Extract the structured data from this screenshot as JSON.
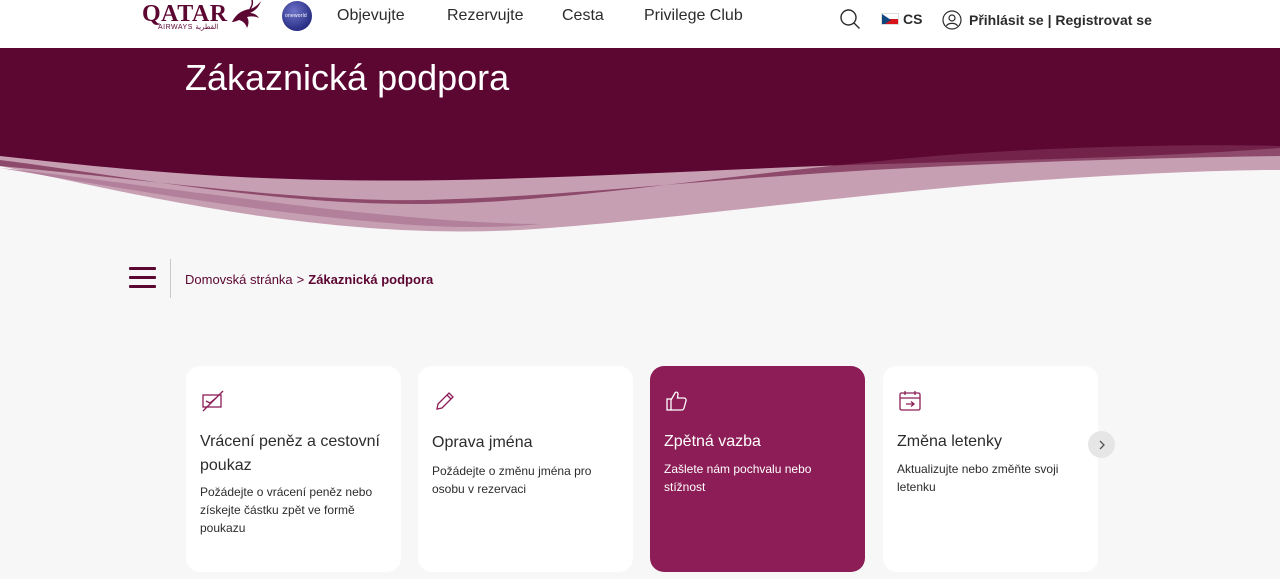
{
  "header": {
    "logo_text": "QATAR",
    "logo_sub": "AIRWAYS القطرية",
    "alliance_text": "oneworld",
    "nav": [
      {
        "label": "Objevujte"
      },
      {
        "label": "Rezervujte"
      },
      {
        "label": "Cesta"
      },
      {
        "label": "Privilege Club"
      }
    ],
    "language": "CS",
    "auth_label": "Přihlásit se | Registrovat se"
  },
  "hero": {
    "title": "Zákaznická podpora"
  },
  "breadcrumb": {
    "home": "Domovská stránka",
    "separator": ">",
    "current": "Zákaznická podpora"
  },
  "cards": [
    {
      "title": "Vrácení peněz a cestovní poukaz",
      "description": "Požádejte o vrácení peněz nebo získejte částku zpět ve formě poukazu",
      "icon": "refund-icon",
      "active": false
    },
    {
      "title": "Oprava jména",
      "description": "Požádejte o změnu jména pro osobu v rezervaci",
      "icon": "pencil-icon",
      "active": false
    },
    {
      "title": "Zpětná vazba",
      "description": "Zašlete nám pochvalu nebo stížnost",
      "icon": "thumbs-up-icon",
      "active": true
    },
    {
      "title": "Změna letenky",
      "description": "Aktualizujte nebo změňte svoji letenku",
      "icon": "calendar-arrow-icon",
      "active": false
    }
  ],
  "colors": {
    "brand": "#5c0632",
    "active_card": "#8c1d56",
    "wave_light": "#c79fb3"
  }
}
